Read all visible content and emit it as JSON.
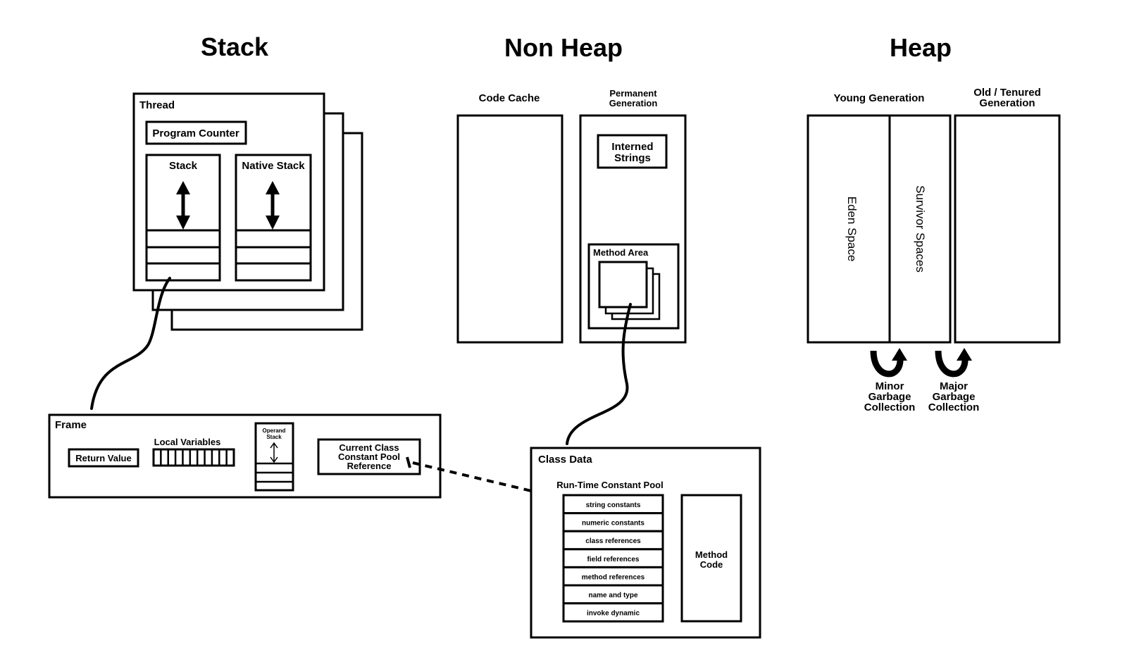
{
  "sections": {
    "stack": "Stack",
    "non_heap": "Non Heap",
    "heap": "Heap"
  },
  "thread": {
    "title": "Thread",
    "program_counter": "Program Counter",
    "stack": "Stack",
    "native_stack": "Native Stack"
  },
  "frame": {
    "title": "Frame",
    "return_value": "Return Value",
    "local_variables": "Local Variables",
    "operand_stack_line1": "Operand",
    "operand_stack_line2": "Stack",
    "ccpr_line1": "Current Class",
    "ccpr_line2": "Constant Pool",
    "ccpr_line3": "Reference"
  },
  "non_heap": {
    "code_cache": "Code Cache",
    "perm_gen_line1": "Permanent",
    "perm_gen_line2": "Generation",
    "interned_line1": "Interned",
    "interned_line2": "Strings",
    "method_area": "Method Area"
  },
  "class_data": {
    "title": "Class Data",
    "rtcp_title": "Run-Time Constant Pool",
    "rtcp_items": [
      "string constants",
      "numeric constants",
      "class references",
      "field references",
      "method references",
      "name and type",
      "invoke dynamic"
    ],
    "method_code_line1": "Method",
    "method_code_line2": "Code"
  },
  "heap": {
    "young_gen": "Young Generation",
    "old_gen_line1": "Old / Tenured",
    "old_gen_line2": "Generation",
    "eden": "Eden Space",
    "survivor": "Survivor Spaces",
    "minor_gc": [
      "Minor",
      "Garbage",
      "Collection"
    ],
    "major_gc": [
      "Major",
      "Garbage",
      "Collection"
    ]
  }
}
